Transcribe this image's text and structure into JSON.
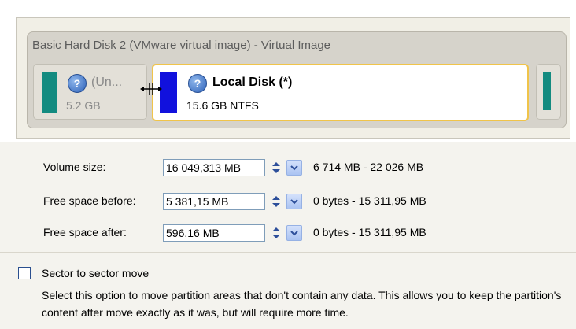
{
  "disk": {
    "title": "Basic Hard Disk 2 (VMware virtual image) - Virtual Image",
    "partitions": [
      {
        "name": "(Un...",
        "size": "5.2 GB",
        "color": "#138b80",
        "icon": "help-icon"
      },
      {
        "name": "Local Disk (*)",
        "size": "15.6 GB NTFS",
        "color": "#1111dd",
        "icon": "help-icon",
        "selected": true
      },
      {
        "name": "",
        "size": "",
        "color": "#138b80"
      }
    ],
    "cursor_icon": "move-cursor-icon"
  },
  "form": {
    "volume_size": {
      "label": "Volume size:",
      "value": "16 049,313 MB",
      "range": "6 714 MB - 22 026 MB"
    },
    "free_before": {
      "label": "Free space before:",
      "value": "5 381,15 MB",
      "range": "0 bytes - 15 311,95 MB"
    },
    "free_after": {
      "label": "Free space after:",
      "value": "596,16 MB",
      "range": "0 bytes - 15 311,95 MB"
    }
  },
  "sector_move": {
    "label": "Sector to sector move",
    "checked": false,
    "description": "Select this option to move partition areas that don't contain any data. This allows you to keep the partition's content after move exactly as it was, but will require more time."
  },
  "colors": {
    "accent_selected_border": "#f0c44a",
    "dropdown_button": "#aac3f2"
  }
}
